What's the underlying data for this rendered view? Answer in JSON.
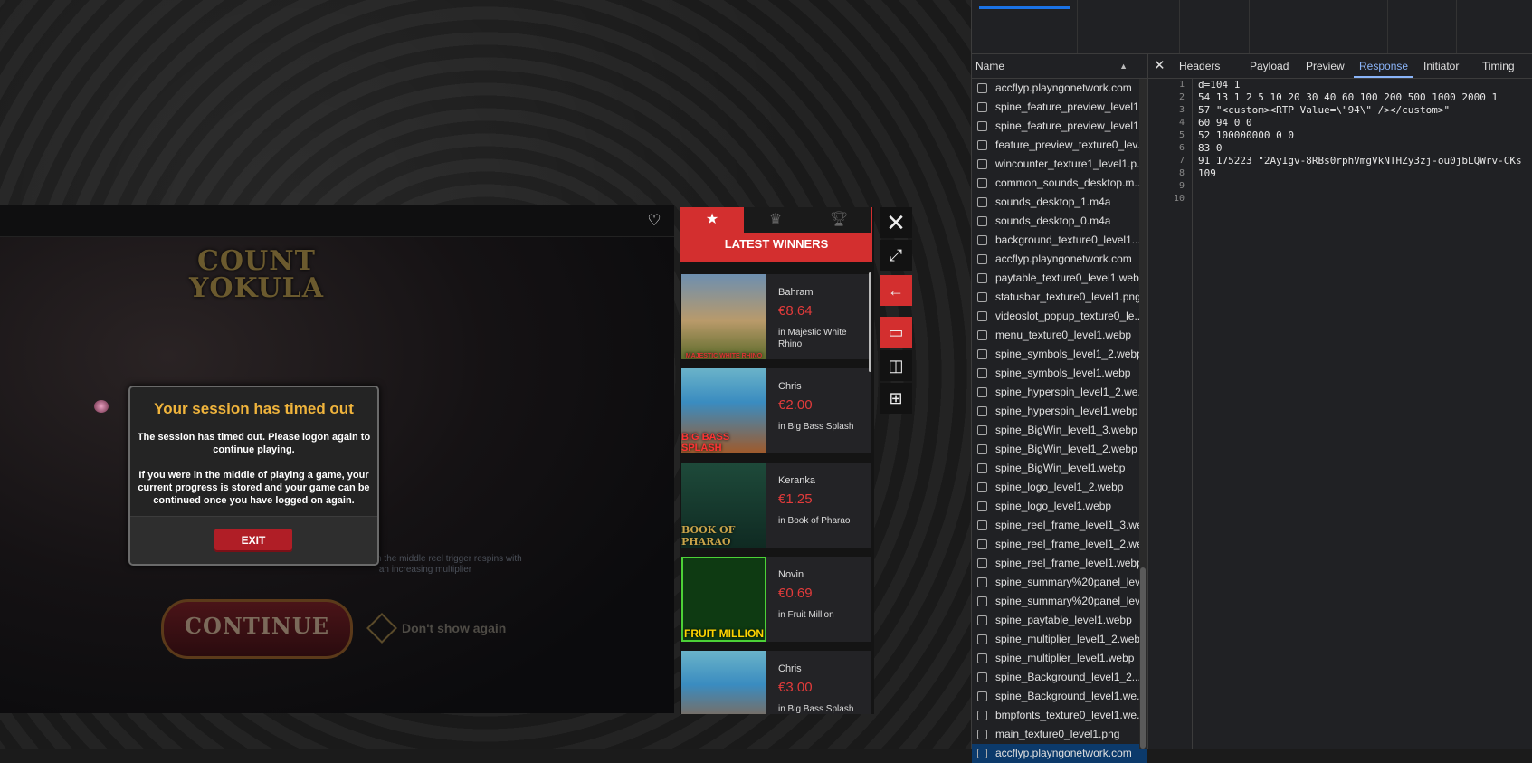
{
  "game": {
    "logo_text": "COUNT YOKULA",
    "favorite_icon": "heart-icon",
    "hint_text": "...ker Wild on the middle reel trigger respins with an increasing multiplier",
    "continue_label": "CONTINUE",
    "dont_show_label": "Don't show again"
  },
  "modal": {
    "title": "Your session has timed out",
    "body1": "The session has timed out. Please logon again to continue playing.",
    "body2": "If you were in the middle of playing a game, your current progress is stored and your game can be continued once you have logged on again.",
    "exit_label": "EXIT"
  },
  "winners": {
    "tabs": [
      "star-icon",
      "crown-icon",
      "trophy-icon"
    ],
    "title": "LATEST WINNERS",
    "items": [
      {
        "name": "Bahram",
        "amount": "€8.64",
        "game": "in Majestic White Rhino",
        "thumb": "MAJESTIC WHITE RHINO"
      },
      {
        "name": "Chris",
        "amount": "€2.00",
        "game": "in Big Bass Splash",
        "thumb": "BIG BASS SPLASH"
      },
      {
        "name": "Keranka",
        "amount": "€1.25",
        "game": "in Book of Pharao",
        "thumb": "BOOK OF PHARAO"
      },
      {
        "name": "Novin",
        "amount": "€0.69",
        "game": "in Fruit Million",
        "thumb": "FRUIT MILLION"
      },
      {
        "name": "Chris",
        "amount": "€3.00",
        "game": "in Big Bass Splash",
        "thumb": ""
      }
    ]
  },
  "side_controls": [
    "close-icon",
    "fullscreen-icon",
    "back-arrow-icon",
    "single-screen-icon",
    "dual-screen-icon",
    "quad-screen-icon"
  ],
  "devtools": {
    "name_header": "Name",
    "requests": [
      "accflyp.playngonetwork.com",
      "spine_feature_preview_level1...",
      "spine_feature_preview_level1...",
      "feature_preview_texture0_lev...",
      "wincounter_texture1_level1.p...",
      "common_sounds_desktop.m...",
      "sounds_desktop_1.m4a",
      "sounds_desktop_0.m4a",
      "background_texture0_level1....",
      "accflyp.playngonetwork.com",
      "paytable_texture0_level1.webp",
      "statusbar_texture0_level1.png",
      "videoslot_popup_texture0_le...",
      "menu_texture0_level1.webp",
      "spine_symbols_level1_2.webp",
      "spine_symbols_level1.webp",
      "spine_hyperspin_level1_2.we...",
      "spine_hyperspin_level1.webp",
      "spine_BigWin_level1_3.webp",
      "spine_BigWin_level1_2.webp",
      "spine_BigWin_level1.webp",
      "spine_logo_level1_2.webp",
      "spine_logo_level1.webp",
      "spine_reel_frame_level1_3.we...",
      "spine_reel_frame_level1_2.we...",
      "spine_reel_frame_level1.webp",
      "spine_summary%20panel_lev...",
      "spine_summary%20panel_lev...",
      "spine_paytable_level1.webp",
      "spine_multiplier_level1_2.webp",
      "spine_multiplier_level1.webp",
      "spine_Background_level1_2....",
      "spine_Background_level1.we...",
      "bmpfonts_texture0_level1.we...",
      "main_texture0_level1.png",
      "accflyp.playngonetwork.com"
    ],
    "tabs": [
      "Headers",
      "Payload",
      "Preview",
      "Response",
      "Initiator",
      "Timing"
    ],
    "active_tab": "Response",
    "response_lines": [
      "d=104 1",
      "54 13 1 2 5 10 20 30 40 60 100 200 500 1000 2000 1",
      "57 \"<custom><RTP Value=\\\"94\\\" /></custom>\"",
      "60 94 0 0",
      "52 100000000 0 0",
      "83 0",
      "91 175223 \"2AyIgv-8RBs0rphVmgVkNTHZy3zj-ou0jbLQWrv-CKs",
      "109",
      "",
      ""
    ],
    "line_numbers": [
      "1",
      "2",
      "3",
      "4",
      "5",
      "6",
      "7",
      "8",
      "9",
      "10"
    ]
  }
}
